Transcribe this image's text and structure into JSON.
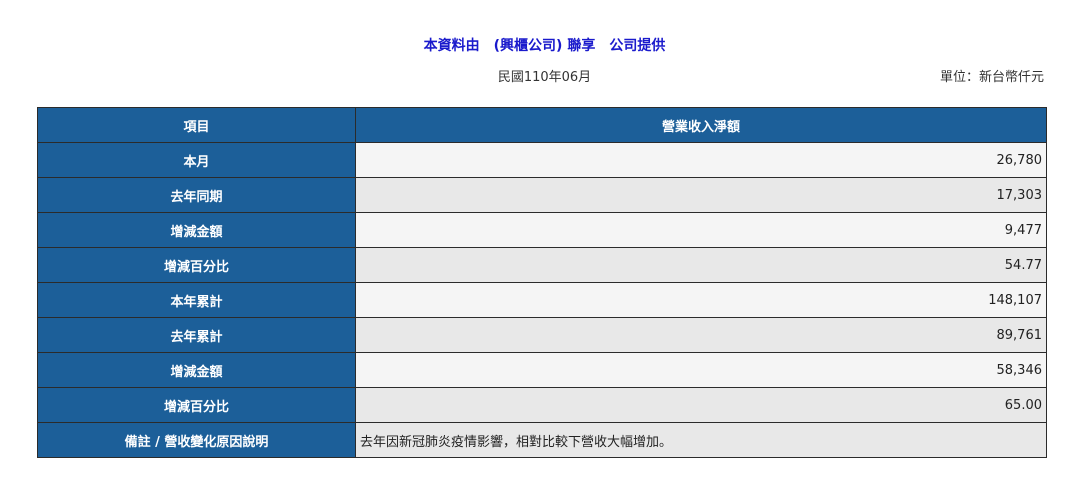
{
  "header": {
    "source_text": "本資料由　(興櫃公司) 聯享　公司提供",
    "period": "民國110年06月",
    "unit": "單位：新台幣仟元"
  },
  "table": {
    "col_item": "項目",
    "col_value": "營業收入淨額",
    "rows": [
      {
        "label": "本月",
        "value": "26,780"
      },
      {
        "label": "去年同期",
        "value": "17,303"
      },
      {
        "label": "增減金額",
        "value": "9,477"
      },
      {
        "label": "增減百分比",
        "value": "54.77"
      },
      {
        "label": "本年累計",
        "value": "148,107"
      },
      {
        "label": "去年累計",
        "value": "89,761"
      },
      {
        "label": "增減金額",
        "value": "58,346"
      },
      {
        "label": "增減百分比",
        "value": "65.00"
      }
    ],
    "note": {
      "label": "備註 / 營收變化原因說明",
      "value": "去年因新冠肺炎疫情影響，相對比較下營收大幅增加。"
    }
  }
}
